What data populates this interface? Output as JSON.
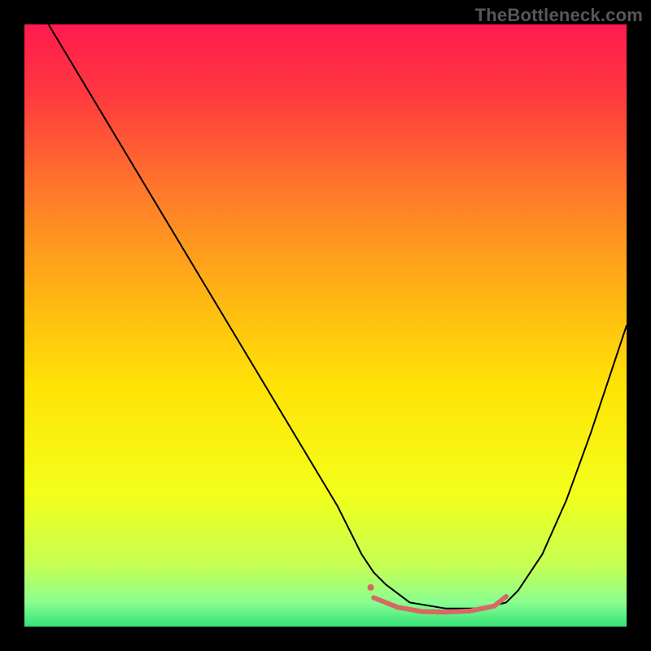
{
  "watermark": "TheBottleneck.com",
  "chart_data": {
    "type": "line",
    "title": "",
    "xlabel": "",
    "ylabel": "",
    "xlim": [
      0,
      100
    ],
    "ylim": [
      0,
      100
    ],
    "grid": false,
    "legend": false,
    "background_gradient": {
      "stops": [
        {
          "offset": 0.0,
          "color": "#ff1a4f"
        },
        {
          "offset": 0.12,
          "color": "#ff3a3f"
        },
        {
          "offset": 0.28,
          "color": "#ff7a2a"
        },
        {
          "offset": 0.45,
          "color": "#ffb514"
        },
        {
          "offset": 0.6,
          "color": "#ffe305"
        },
        {
          "offset": 0.78,
          "color": "#f3ff1a"
        },
        {
          "offset": 0.9,
          "color": "#c4ff55"
        },
        {
          "offset": 0.96,
          "color": "#8aff90"
        },
        {
          "offset": 1.0,
          "color": "#34e27a"
        }
      ]
    },
    "series": [
      {
        "name": "bottleneck-curve",
        "stroke": "#000000",
        "stroke_width": 2,
        "x": [
          4,
          10,
          16,
          22,
          28,
          34,
          40,
          46,
          52,
          56,
          58,
          60,
          64,
          70,
          76,
          80,
          82,
          86,
          90,
          94,
          98,
          100
        ],
        "values": [
          100,
          90,
          80,
          70,
          60,
          50,
          40,
          30,
          20,
          12,
          9,
          7,
          4,
          3,
          3,
          4,
          6,
          12,
          21,
          32,
          44,
          50
        ]
      },
      {
        "name": "optimal-flat-marker",
        "stroke": "#d46a63",
        "stroke_width": 6,
        "x": [
          58,
          62,
          66,
          70,
          74,
          78,
          80
        ],
        "values": [
          4.8,
          3.2,
          2.5,
          2.4,
          2.6,
          3.4,
          5.0
        ]
      }
    ],
    "points": [
      {
        "name": "optimal-start-dot",
        "x": 57.5,
        "y": 6.5,
        "r": 4,
        "fill": "#d46a63"
      }
    ]
  }
}
